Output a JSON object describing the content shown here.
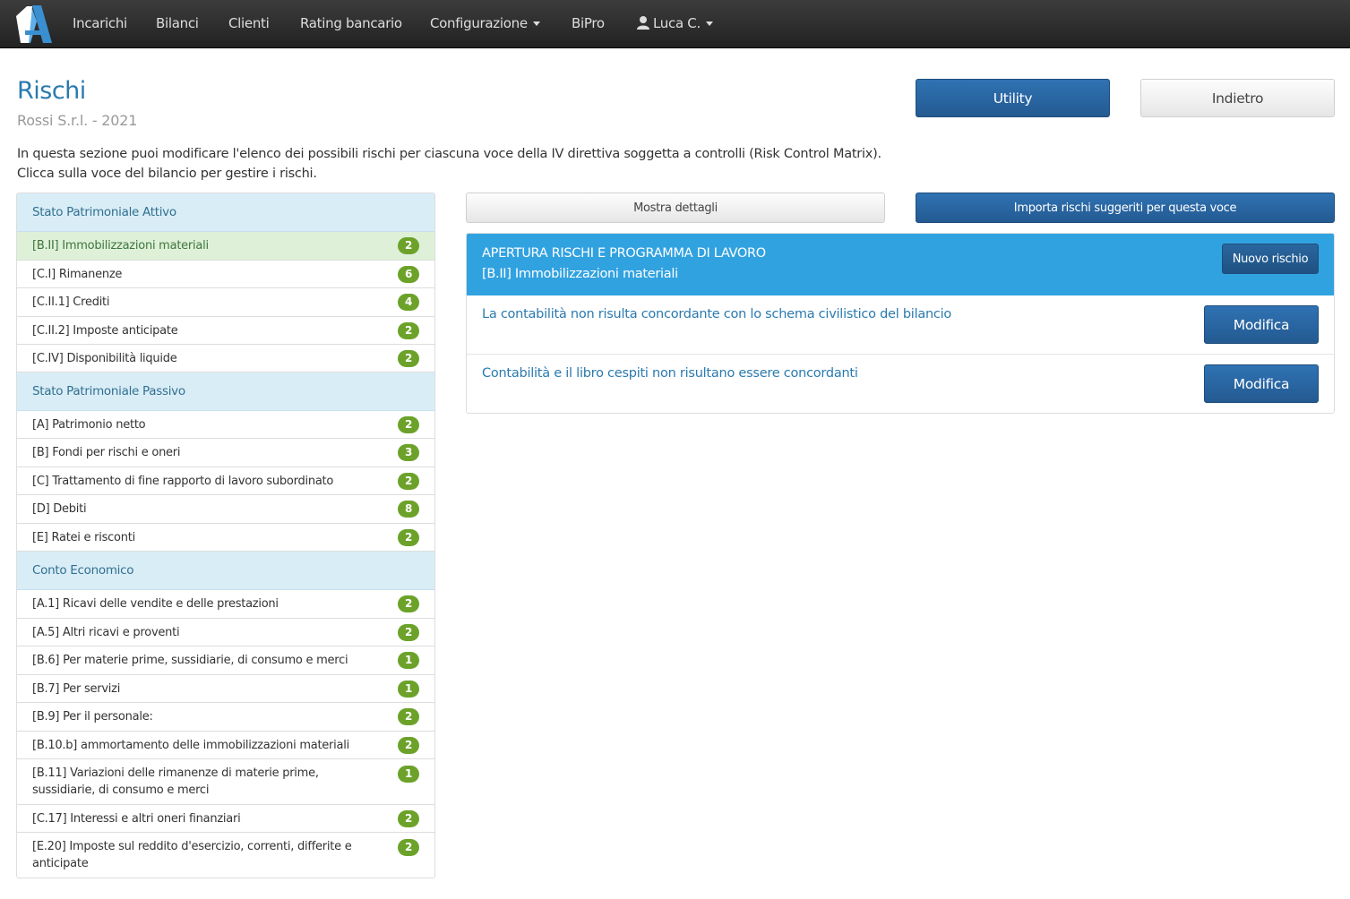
{
  "nav": {
    "items": [
      "Incarichi",
      "Bilanci",
      "Clienti",
      "Rating bancario",
      "Configurazione",
      "BiPro"
    ],
    "user": "Luca C."
  },
  "header": {
    "title": "Rischi",
    "subtitle": "Rossi S.r.l. - 2021",
    "intro_line1": "In questa sezione puoi modificare l'elenco dei possibili rischi per ciascuna voce della IV direttiva soggetta a controlli (Risk Control Matrix).",
    "intro_line2": "Clicca sulla voce del bilancio per gestire i rischi.",
    "utility_label": "Utility",
    "back_label": "Indietro"
  },
  "toolbar": {
    "details_label": "Mostra dettagli",
    "import_label": "Importa rischi suggeriti per questa voce"
  },
  "sections": [
    {
      "title": "Stato Patrimoniale Attivo",
      "items": [
        {
          "label": "[B.II] Immobilizzazioni materiali",
          "count": "2"
        },
        {
          "label": "[C.I] Rimanenze",
          "count": "6"
        },
        {
          "label": "[C.II.1] Crediti",
          "count": "4"
        },
        {
          "label": "[C.II.2] Imposte anticipate",
          "count": "2"
        },
        {
          "label": "[C.IV] Disponibilità liquide",
          "count": "2"
        }
      ]
    },
    {
      "title": "Stato Patrimoniale Passivo",
      "items": [
        {
          "label": "[A] Patrimonio netto",
          "count": "2"
        },
        {
          "label": "[B] Fondi per rischi e oneri",
          "count": "3"
        },
        {
          "label": "[C] Trattamento di fine rapporto di lavoro subordinato",
          "count": "2"
        },
        {
          "label": "[D] Debiti",
          "count": "8"
        },
        {
          "label": "[E] Ratei e risconti",
          "count": "2"
        }
      ]
    },
    {
      "title": "Conto Economico",
      "items": [
        {
          "label": "[A.1] Ricavi delle vendite e delle prestazioni",
          "count": "2"
        },
        {
          "label": "[A.5] Altri ricavi e proventi",
          "count": "2"
        },
        {
          "label": "[B.6] Per materie prime, sussidiarie, di consumo e merci",
          "count": "1"
        },
        {
          "label": "[B.7] Per servizi",
          "count": "1"
        },
        {
          "label": "[B.9] Per il personale:",
          "count": "2"
        },
        {
          "label": "[B.10.b] ammortamento delle immobilizzazioni materiali",
          "count": "2"
        },
        {
          "label": "[B.11] Variazioni delle rimanenze di materie prime, sussidiarie, di consumo e merci",
          "count": "1"
        },
        {
          "label": "[C.17] Interessi e altri oneri finanziari",
          "count": "2"
        },
        {
          "label": "[E.20] Imposte sul reddito d'esercizio, correnti, differite e anticipate",
          "count": "2"
        }
      ]
    }
  ],
  "risk_panel": {
    "heading": "APERTURA RISCHI E PROGRAMMA DI LAVORO",
    "voce": "[B.II] Immobilizzazioni materiali",
    "new_label": "Nuovo rischio",
    "risks": [
      {
        "text": "La contabilità non risulta concordante con lo schema civilistico del bilancio",
        "action": "Modifica"
      },
      {
        "text": "Contabilità e il libro cespiti non risultano essere concordanti",
        "action": "Modifica"
      }
    ]
  },
  "colors": {
    "accent": "#2a7aaf",
    "panel_header": "#31a2e0",
    "badge": "#6ca22a",
    "group_bg": "#d9edf7",
    "active_bg": "#dff0d8"
  }
}
